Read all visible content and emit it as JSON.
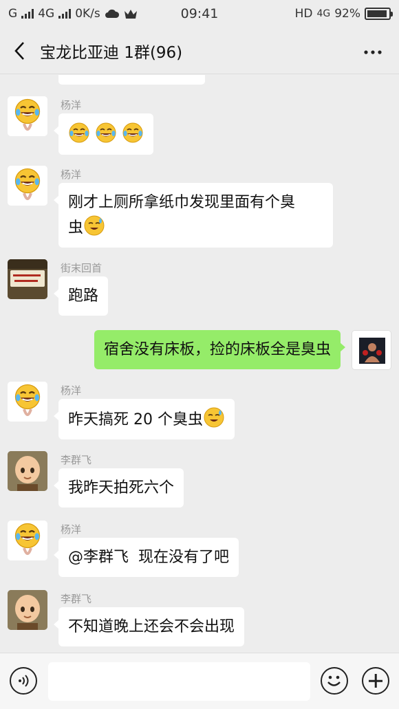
{
  "status_bar": {
    "carrier_g": "G",
    "network": "4G",
    "speed": "0K/s",
    "time": "09:41",
    "hd": "HD",
    "net2": "4G",
    "battery": "92%"
  },
  "header": {
    "title": "宝龙比亚迪 1群(96)",
    "back_icon": "chevron-left-icon",
    "more_icon": "more-dots-icon"
  },
  "messages": [
    {
      "sender": "杨洋",
      "text": "",
      "emojis": [
        "laugh-cry",
        "laugh-cry",
        "laugh-cry"
      ]
    },
    {
      "sender": "杨洋",
      "text": "刚才上厕所拿纸巾发现里面有个臭",
      "text2": "虫"
    },
    {
      "sender": "街末回首",
      "text": "跑路"
    },
    {
      "sender": "me",
      "text": "宿舍没有床板，捡的床板全是臭虫"
    },
    {
      "sender": "杨洋",
      "text": "昨天搞死 20 个臭虫"
    },
    {
      "sender": "李群飞",
      "text": "我昨天拍死六个"
    },
    {
      "sender": "杨洋",
      "text": "@李群飞  现在没有了吧"
    },
    {
      "sender": "李群飞",
      "text": "不知道晚上还会不会出现"
    }
  ],
  "input_bar": {
    "placeholder": "",
    "voice_icon": "voice-icon",
    "emoji_icon": "smiley-icon",
    "plus_icon": "plus-icon"
  },
  "colors": {
    "background": "#ededed",
    "my_bubble": "#95ec69",
    "other_bubble": "#ffffff"
  }
}
